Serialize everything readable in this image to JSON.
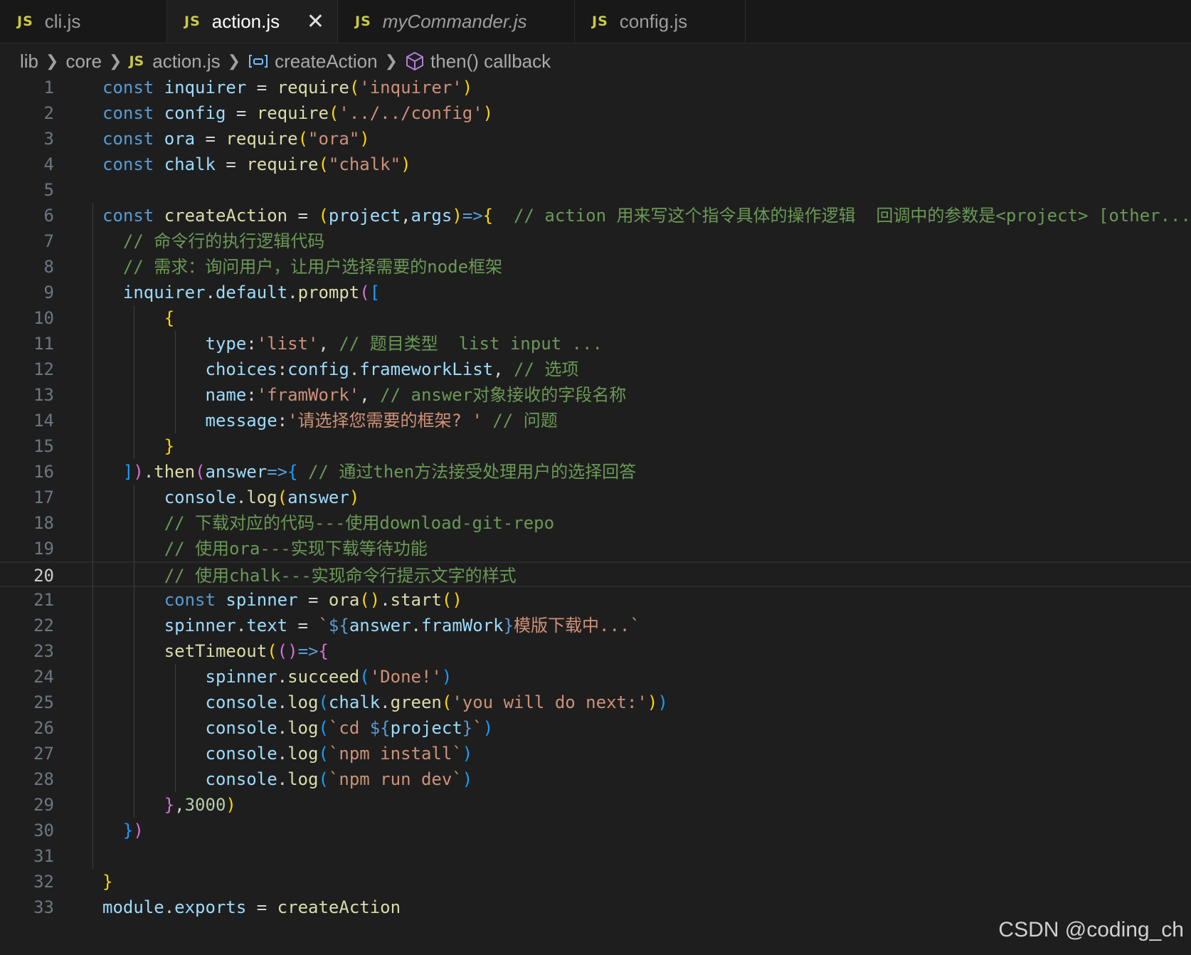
{
  "tabs": [
    {
      "label": "cli.js",
      "icon": "js-icon"
    },
    {
      "label": "action.js",
      "icon": "js-icon",
      "active": true,
      "close_glyph": "✕"
    },
    {
      "label": "myCommander.js",
      "icon": "js-icon",
      "italic": true
    },
    {
      "label": "config.js",
      "icon": "js-icon"
    }
  ],
  "breadcrumb": {
    "items": [
      "lib",
      "core",
      "action.js",
      "createAction",
      "then() callback"
    ]
  },
  "editor": {
    "current_line": 20,
    "lines": [
      [
        [
          "k",
          "const "
        ],
        [
          "v",
          "inquirer"
        ],
        [
          "t",
          " = "
        ],
        [
          "f",
          "require"
        ],
        [
          "p1",
          "("
        ],
        [
          "s",
          "'inquirer'"
        ],
        [
          "p1",
          ")"
        ]
      ],
      [
        [
          "k",
          "const "
        ],
        [
          "v",
          "config"
        ],
        [
          "t",
          " = "
        ],
        [
          "f",
          "require"
        ],
        [
          "p1",
          "("
        ],
        [
          "s",
          "'../../config'"
        ],
        [
          "p1",
          ")"
        ]
      ],
      [
        [
          "k",
          "const "
        ],
        [
          "v",
          "ora"
        ],
        [
          "t",
          " = "
        ],
        [
          "f",
          "require"
        ],
        [
          "p1",
          "("
        ],
        [
          "s",
          "\"ora\""
        ],
        [
          "p1",
          ")"
        ]
      ],
      [
        [
          "k",
          "const "
        ],
        [
          "v",
          "chalk"
        ],
        [
          "t",
          " = "
        ],
        [
          "f",
          "require"
        ],
        [
          "p1",
          "("
        ],
        [
          "s",
          "\"chalk\""
        ],
        [
          "p1",
          ")"
        ]
      ],
      [],
      [
        [
          "k",
          "const "
        ],
        [
          "f",
          "createAction"
        ],
        [
          "t",
          " = "
        ],
        [
          "p1",
          "("
        ],
        [
          "v",
          "project"
        ],
        [
          "t",
          ","
        ],
        [
          "v",
          "args"
        ],
        [
          "p1",
          ")"
        ],
        [
          "k",
          "=>"
        ],
        [
          "p1",
          "{"
        ],
        [
          "c",
          "  // action 用来写这个指令具体的操作逻辑  回调中的参数是<project> [other..."
        ]
      ],
      [
        [
          "t",
          "  "
        ],
        [
          "c",
          "// 命令行的执行逻辑代码"
        ]
      ],
      [
        [
          "t",
          "  "
        ],
        [
          "c",
          "// 需求：询问用户，让用户选择需要的node框架"
        ]
      ],
      [
        [
          "t",
          "  "
        ],
        [
          "v",
          "inquirer"
        ],
        [
          "t",
          "."
        ],
        [
          "v",
          "default"
        ],
        [
          "t",
          "."
        ],
        [
          "f",
          "prompt"
        ],
        [
          "p2",
          "("
        ],
        [
          "p3",
          "["
        ]
      ],
      [
        [
          "t",
          "      "
        ],
        [
          "p1",
          "{"
        ]
      ],
      [
        [
          "t",
          "          "
        ],
        [
          "v",
          "type"
        ],
        [
          "t",
          ":"
        ],
        [
          "s",
          "'list'"
        ],
        [
          "t",
          ", "
        ],
        [
          "c",
          "// 题目类型  list input ..."
        ]
      ],
      [
        [
          "t",
          "          "
        ],
        [
          "v",
          "choices"
        ],
        [
          "t",
          ":"
        ],
        [
          "v",
          "config"
        ],
        [
          "t",
          "."
        ],
        [
          "v",
          "frameworkList"
        ],
        [
          "t",
          ", "
        ],
        [
          "c",
          "// 选项"
        ]
      ],
      [
        [
          "t",
          "          "
        ],
        [
          "v",
          "name"
        ],
        [
          "t",
          ":"
        ],
        [
          "s",
          "'framWork'"
        ],
        [
          "t",
          ", "
        ],
        [
          "c",
          "// answer对象接收的字段名称"
        ]
      ],
      [
        [
          "t",
          "          "
        ],
        [
          "v",
          "message"
        ],
        [
          "t",
          ":"
        ],
        [
          "s",
          "'请选择您需要的框架? '"
        ],
        [
          "t",
          " "
        ],
        [
          "c",
          "// 问题"
        ]
      ],
      [
        [
          "t",
          "      "
        ],
        [
          "p1",
          "}"
        ]
      ],
      [
        [
          "t",
          "  "
        ],
        [
          "p3",
          "]"
        ],
        [
          "p2",
          ")"
        ],
        [
          "t",
          "."
        ],
        [
          "f",
          "then"
        ],
        [
          "p2",
          "("
        ],
        [
          "v",
          "answer"
        ],
        [
          "k",
          "=>"
        ],
        [
          "p3",
          "{"
        ],
        [
          "t",
          " "
        ],
        [
          "c",
          "// 通过then方法接受处理用户的选择回答"
        ]
      ],
      [
        [
          "t",
          "      "
        ],
        [
          "v",
          "console"
        ],
        [
          "t",
          "."
        ],
        [
          "f",
          "log"
        ],
        [
          "p1",
          "("
        ],
        [
          "v",
          "answer"
        ],
        [
          "p1",
          ")"
        ]
      ],
      [
        [
          "t",
          "      "
        ],
        [
          "c",
          "// 下载对应的代码---使用download-git-repo"
        ]
      ],
      [
        [
          "t",
          "      "
        ],
        [
          "c",
          "// 使用ora---实现下载等待功能"
        ]
      ],
      [
        [
          "t",
          "      "
        ],
        [
          "c",
          "// 使用chalk---实现命令行提示文字的样式"
        ]
      ],
      [
        [
          "t",
          "      "
        ],
        [
          "k",
          "const "
        ],
        [
          "v",
          "spinner"
        ],
        [
          "t",
          " = "
        ],
        [
          "f",
          "ora"
        ],
        [
          "p1",
          "()"
        ],
        [
          "t",
          "."
        ],
        [
          "f",
          "start"
        ],
        [
          "p1",
          "()"
        ]
      ],
      [
        [
          "t",
          "      "
        ],
        [
          "v",
          "spinner"
        ],
        [
          "t",
          "."
        ],
        [
          "v",
          "text"
        ],
        [
          "t",
          " = "
        ],
        [
          "s",
          "`"
        ],
        [
          "k",
          "${"
        ],
        [
          "v",
          "answer"
        ],
        [
          "t",
          "."
        ],
        [
          "v",
          "framWork"
        ],
        [
          "k",
          "}"
        ],
        [
          "s",
          "模版下载中...`"
        ]
      ],
      [
        [
          "t",
          "      "
        ],
        [
          "f",
          "setTimeout"
        ],
        [
          "p1",
          "("
        ],
        [
          "p2",
          "()"
        ],
        [
          "k",
          "=>"
        ],
        [
          "p2",
          "{"
        ]
      ],
      [
        [
          "t",
          "          "
        ],
        [
          "v",
          "spinner"
        ],
        [
          "t",
          "."
        ],
        [
          "f",
          "succeed"
        ],
        [
          "p3",
          "("
        ],
        [
          "s",
          "'Done!'"
        ],
        [
          "p3",
          ")"
        ]
      ],
      [
        [
          "t",
          "          "
        ],
        [
          "v",
          "console"
        ],
        [
          "t",
          "."
        ],
        [
          "f",
          "log"
        ],
        [
          "p3",
          "("
        ],
        [
          "v",
          "chalk"
        ],
        [
          "t",
          "."
        ],
        [
          "f",
          "green"
        ],
        [
          "p1",
          "("
        ],
        [
          "s",
          "'you will do next:'"
        ],
        [
          "p1",
          ")"
        ],
        [
          "p3",
          ")"
        ]
      ],
      [
        [
          "t",
          "          "
        ],
        [
          "v",
          "console"
        ],
        [
          "t",
          "."
        ],
        [
          "f",
          "log"
        ],
        [
          "p3",
          "("
        ],
        [
          "s",
          "`cd "
        ],
        [
          "k",
          "${"
        ],
        [
          "v",
          "project"
        ],
        [
          "k",
          "}"
        ],
        [
          "s",
          "`"
        ],
        [
          "p3",
          ")"
        ]
      ],
      [
        [
          "t",
          "          "
        ],
        [
          "v",
          "console"
        ],
        [
          "t",
          "."
        ],
        [
          "f",
          "log"
        ],
        [
          "p3",
          "("
        ],
        [
          "s",
          "`npm install`"
        ],
        [
          "p3",
          ")"
        ]
      ],
      [
        [
          "t",
          "          "
        ],
        [
          "v",
          "console"
        ],
        [
          "t",
          "."
        ],
        [
          "f",
          "log"
        ],
        [
          "p3",
          "("
        ],
        [
          "s",
          "`npm run dev`"
        ],
        [
          "p3",
          ")"
        ]
      ],
      [
        [
          "t",
          "      "
        ],
        [
          "p2",
          "}"
        ],
        [
          "t",
          ","
        ],
        [
          "n",
          "3000"
        ],
        [
          "p1",
          ")"
        ]
      ],
      [
        [
          "t",
          "  "
        ],
        [
          "p3",
          "}"
        ],
        [
          "p2",
          ")"
        ]
      ],
      [],
      [
        [
          "p1",
          "}"
        ]
      ],
      [
        [
          "v",
          "module"
        ],
        [
          "t",
          "."
        ],
        [
          "v",
          "exports"
        ],
        [
          "t",
          " = "
        ],
        [
          "f",
          "createAction"
        ]
      ]
    ]
  },
  "watermark": "CSDN @coding_ch",
  "colors": {
    "background": "#1e1e1e",
    "keyword": "#569cd6",
    "variable": "#9cdcfe",
    "function": "#dcdcaa",
    "string": "#ce9178",
    "comment": "#6a9955",
    "js_icon": "#cbcb41"
  }
}
